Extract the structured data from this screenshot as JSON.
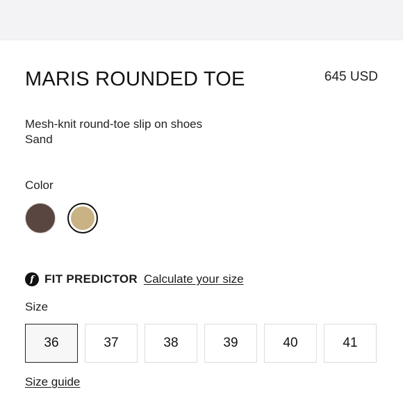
{
  "product": {
    "title": "MARIS ROUNDED TOE",
    "price": "645 USD",
    "description_line1": "Mesh-knit round-toe slip on shoes",
    "description_line2": "Sand"
  },
  "color": {
    "label": "Color",
    "swatches": [
      {
        "name": "brown",
        "hex": "#5a4640",
        "selected": false
      },
      {
        "name": "sand",
        "hex": "#c9b385",
        "selected": true
      }
    ]
  },
  "fit_predictor": {
    "icon": "fit-predictor-icon",
    "icon_glyph": "f",
    "title": "FIT PREDICTOR",
    "link": "Calculate your size"
  },
  "size": {
    "label": "Size",
    "options": [
      "36",
      "37",
      "38",
      "39",
      "40",
      "41"
    ],
    "selected": "36",
    "guide_link": "Size guide"
  }
}
